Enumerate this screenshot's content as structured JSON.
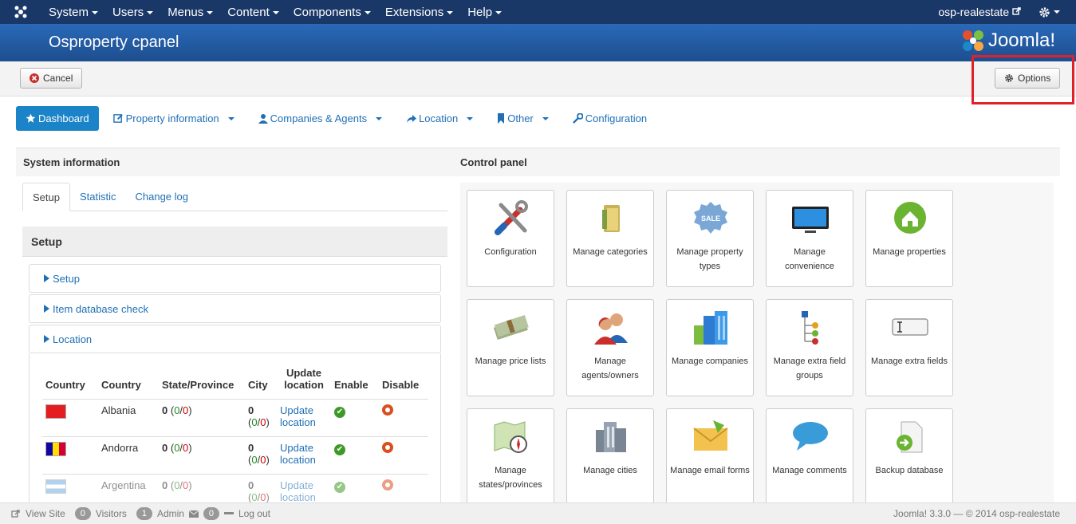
{
  "topnav": {
    "menus": [
      "System",
      "Users",
      "Menus",
      "Content",
      "Components",
      "Extensions",
      "Help"
    ],
    "site_link": "osp-realestate",
    "settings_icon": "gear-icon"
  },
  "header": {
    "title": "Osproperty cpanel",
    "brand": "Joomla!"
  },
  "toolbar": {
    "cancel_label": "Cancel",
    "options_label": "Options"
  },
  "subnav": {
    "dashboard": "Dashboard",
    "property": "Property information",
    "companies": "Companies & Agents",
    "location": "Location",
    "other": "Other",
    "configuration": "Configuration"
  },
  "left_panel": {
    "title": "System information",
    "tabs": [
      "Setup",
      "Statistic",
      "Change log"
    ],
    "section_title": "Setup",
    "accordion": [
      "Setup",
      "Item database check",
      "Location"
    ]
  },
  "location_table": {
    "headers": [
      "Country",
      "Country",
      "State/Province",
      "City",
      "Update location",
      "Enable",
      "Disable"
    ],
    "rows": [
      {
        "country": "Albania",
        "states_total": "0",
        "states_on": "0",
        "states_off": "0",
        "city_total": "0",
        "city_on": "0",
        "city_off": "0",
        "update": "Update location",
        "flag_color": "#e41e20"
      },
      {
        "country": "Andorra",
        "states_total": "0",
        "states_on": "0",
        "states_off": "0",
        "city_total": "0",
        "city_on": "0",
        "city_off": "0",
        "update": "Update location",
        "flag_color": "#fedf00"
      },
      {
        "country": "Argentina",
        "states_total": "0",
        "states_on": "0",
        "states_off": "0",
        "city_total": "0",
        "city_on": "0",
        "city_off": "0",
        "update": "Update location",
        "flag_color": "#74acdf"
      }
    ]
  },
  "right_panel": {
    "title": "Control panel",
    "tiles": [
      "Configuration",
      "Manage categories",
      "Manage property types",
      "Manage convenience",
      "Manage properties",
      "Manage price lists",
      "Manage agents/owners",
      "Manage companies",
      "Manage extra field groups",
      "Manage extra fields",
      "Manage states/provinces",
      "Manage cities",
      "Manage email forms",
      "Manage comments",
      "Backup database"
    ]
  },
  "footer": {
    "view_site": "View Site",
    "visitors_count": "0",
    "visitors_label": "Visitors",
    "admin_count": "1",
    "admin_label": "Admin",
    "messages_count": "0",
    "logout": "Log out",
    "copyright": "Joomla! 3.3.0 — © 2014 osp-realestate"
  },
  "colors": {
    "topbar": "#1a3867",
    "header": "#2a69b8",
    "accent": "#1b83c7",
    "highlight": "#e0212a"
  }
}
